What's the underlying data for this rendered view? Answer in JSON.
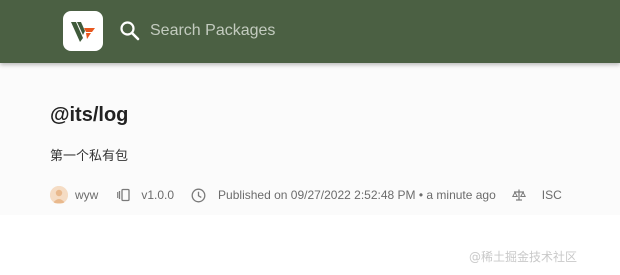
{
  "header": {
    "logo_alt": "Verdaccio",
    "search_placeholder": "Search Packages"
  },
  "package": {
    "name": "@its/log",
    "description": "第一个私有包",
    "author": "wyw",
    "version": "v1.0.0",
    "published": "Published on 09/27/2022 2:52:48 PM • a minute ago",
    "license": "ISC"
  },
  "watermark": "@稀土掘金技术社区",
  "colors": {
    "header_bg": "#4b6043",
    "logo_v_dark": "#3f5a3a",
    "logo_accent": "#e8571e"
  },
  "icons": {
    "logo": "verdaccio-logo-icon",
    "search": "search-icon",
    "version": "version-icon",
    "time": "clock-icon",
    "license": "scale-icon"
  }
}
